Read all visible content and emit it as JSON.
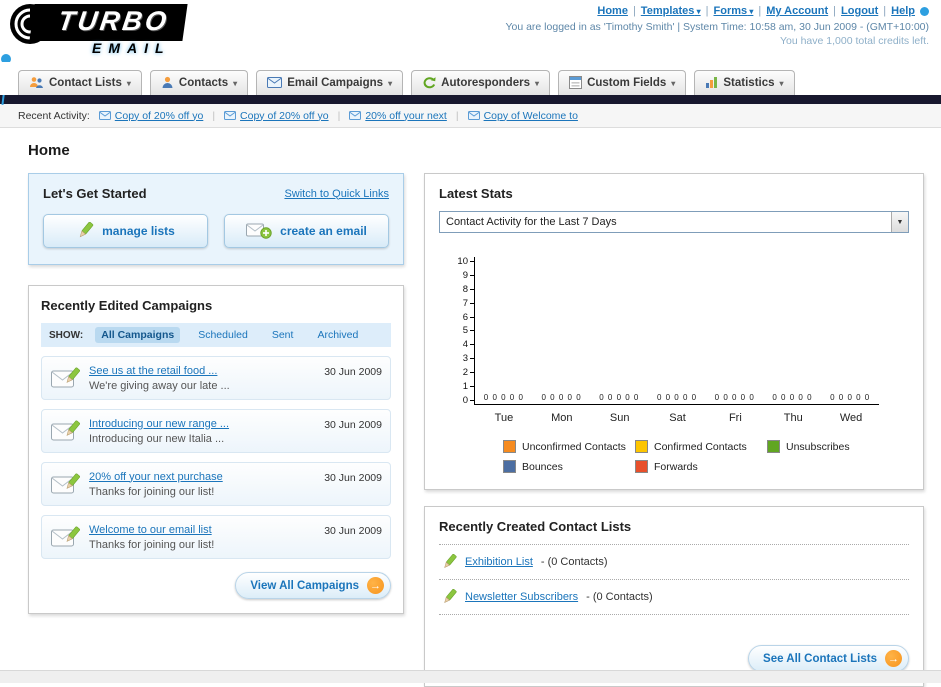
{
  "page_title": "Home",
  "header": {
    "logo_primary": "TURBO",
    "logo_secondary": "EMAIL",
    "links": [
      {
        "label": "Home"
      },
      {
        "label": "Templates"
      },
      {
        "label": "Forms"
      },
      {
        "label": "My Account"
      },
      {
        "label": "Logout"
      },
      {
        "label": "Help"
      }
    ],
    "login_info": "You are logged in as 'Timothy Smith' | System Time: 10:58 am, 30 Jun 2009 - (GMT+10:00)",
    "credits_info": "You have 1,000 total credits left."
  },
  "nav": {
    "tabs": [
      {
        "label": "Contact Lists"
      },
      {
        "label": "Contacts"
      },
      {
        "label": "Email Campaigns"
      },
      {
        "label": "Autoresponders"
      },
      {
        "label": "Custom Fields"
      },
      {
        "label": "Statistics"
      }
    ]
  },
  "recent_activity": {
    "label": "Recent Activity:",
    "items": [
      {
        "label": "Copy of 20% off yo"
      },
      {
        "label": "Copy of 20% off yo"
      },
      {
        "label": "20% off your next "
      },
      {
        "label": "Copy of Welcome to"
      }
    ]
  },
  "get_started": {
    "title": "Let's Get Started",
    "switch_link": "Switch to Quick Links",
    "manage_lists_label": "manage lists",
    "create_email_label": "create an email"
  },
  "campaigns": {
    "title": "Recently Edited Campaigns",
    "show_label": "SHOW:",
    "filters": [
      {
        "label": "All Campaigns"
      },
      {
        "label": "Scheduled"
      },
      {
        "label": "Sent"
      },
      {
        "label": "Archived"
      }
    ],
    "items": [
      {
        "title": "See us at the retail food ...",
        "subtitle": "We're giving away our late ...",
        "date": "30 Jun 2009"
      },
      {
        "title": "Introducing our new range ...",
        "subtitle": "Introducing our new Italia ...",
        "date": "30 Jun 2009"
      },
      {
        "title": "20% off your next purchase",
        "subtitle": "Thanks for joining our list!",
        "date": "30 Jun 2009"
      },
      {
        "title": "Welcome to our email list",
        "subtitle": "Thanks for joining our list!",
        "date": "30 Jun 2009"
      }
    ],
    "view_all_label": "View All Campaigns"
  },
  "stats": {
    "title": "Latest Stats",
    "period_selected": "Contact Activity for the Last 7 Days",
    "chart_data": {
      "type": "bar",
      "title": "Contact Activity for the Last 7 Days",
      "categories": [
        "Tue",
        "Mon",
        "Sun",
        "Sat",
        "Fri",
        "Thu",
        "Wed"
      ],
      "series": [
        {
          "name": "Unconfirmed Contacts",
          "color": "#f68b1f",
          "values": [
            0,
            0,
            0,
            0,
            0,
            0,
            0
          ]
        },
        {
          "name": "Confirmed Contacts",
          "color": "#fdc500",
          "values": [
            0,
            0,
            0,
            0,
            0,
            0,
            0
          ]
        },
        {
          "name": "Unsubscribes",
          "color": "#61a621",
          "values": [
            0,
            0,
            0,
            0,
            0,
            0,
            0
          ]
        },
        {
          "name": "Bounces",
          "color": "#4c6ea2",
          "values": [
            0,
            0,
            0,
            0,
            0,
            0,
            0
          ]
        },
        {
          "name": "Forwards",
          "color": "#e8502b",
          "values": [
            0,
            0,
            0,
            0,
            0,
            0,
            0
          ]
        }
      ],
      "ylim": [
        0,
        10
      ],
      "y_ticks": [
        "10",
        "9",
        "8",
        "7",
        "6",
        "5",
        "4",
        "3",
        "2",
        "1",
        "0"
      ],
      "bar_value_display": "0 0 0 0 0",
      "grid": false,
      "legend_position": "bottom"
    }
  },
  "contact_lists": {
    "title": "Recently Created Contact Lists",
    "items": [
      {
        "name": "Exhibition List",
        "suffix": "- (0 Contacts)"
      },
      {
        "name": "Newsletter Subscribers",
        "suffix": "- (0 Contacts)"
      }
    ],
    "see_all_label": "See All Contact Lists"
  }
}
